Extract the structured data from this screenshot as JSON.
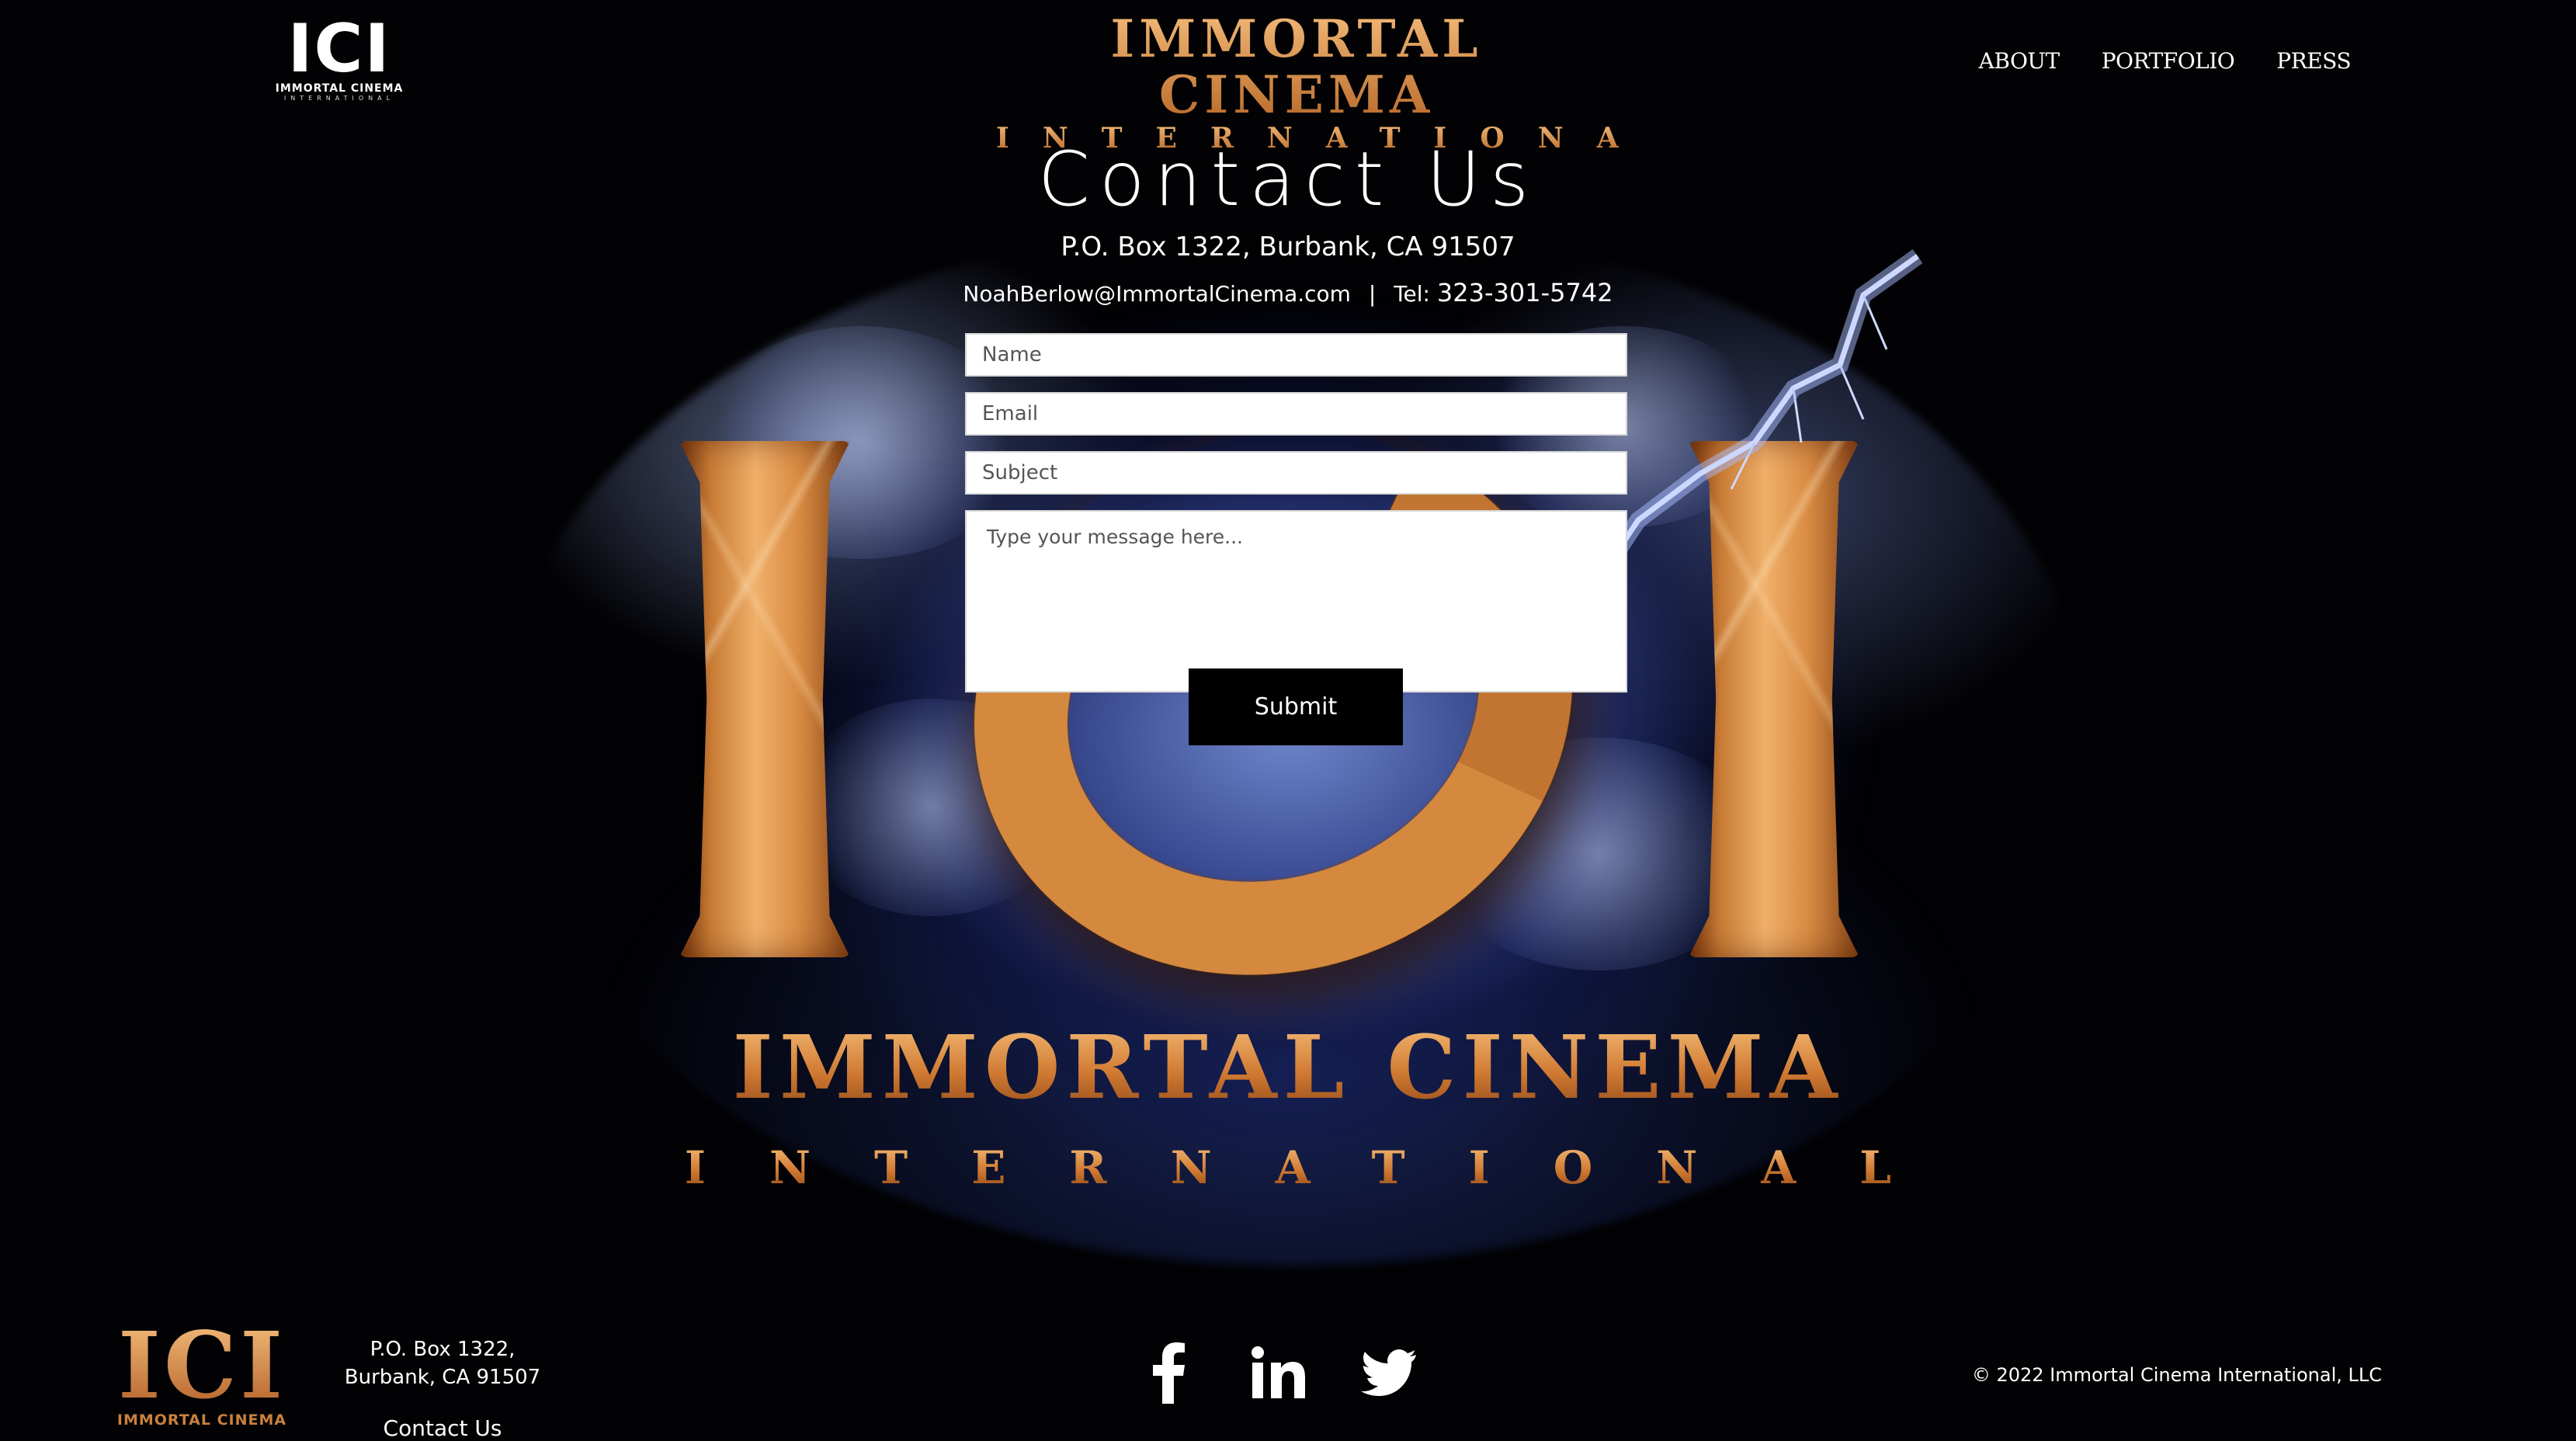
{
  "header": {
    "logo": {
      "letters": "ICI",
      "tagline": "IMMORTAL CINEMA",
      "sub": "INTERNATIONAL"
    },
    "title": {
      "main": "IMMORTAL CINEMA",
      "sub": "INTERNATIONAL"
    },
    "nav": [
      {
        "label": "ABOUT"
      },
      {
        "label": "PORTFOLIO"
      },
      {
        "label": "PRESS"
      }
    ]
  },
  "hero": {
    "wordmark_main": "IMMORTAL CINEMA",
    "wordmark_sub": "INTERNATIONAL"
  },
  "contact": {
    "title": "Contact Us",
    "address": "P.O. Box 1322, Burbank, CA 91507",
    "email": "NoahBerlow@ImmortalCinema.com",
    "separator": "|",
    "tel_label": "Tel:",
    "tel_number": "323-301-5742"
  },
  "form": {
    "name_placeholder": "Name",
    "email_placeholder": "Email",
    "subject_placeholder": "Subject",
    "message_placeholder": "Type your message here...",
    "submit_label": "Submit"
  },
  "footer": {
    "logo": {
      "letters": "ICI",
      "tagline": "IMMORTAL CINEMA"
    },
    "address_line1": "P.O. Box 1322,",
    "address_line2": "Burbank, CA 91507",
    "contact_link": "Contact Us",
    "social": [
      {
        "icon": "facebook-icon"
      },
      {
        "icon": "linkedin-icon"
      },
      {
        "icon": "twitter-icon"
      }
    ],
    "copyright": "© 2022 Immortal Cinema International, LLC"
  },
  "colors": {
    "background": "#000000",
    "gold": "#d4893e",
    "storm_blue": "#3a4ea0",
    "button": "#000000"
  }
}
